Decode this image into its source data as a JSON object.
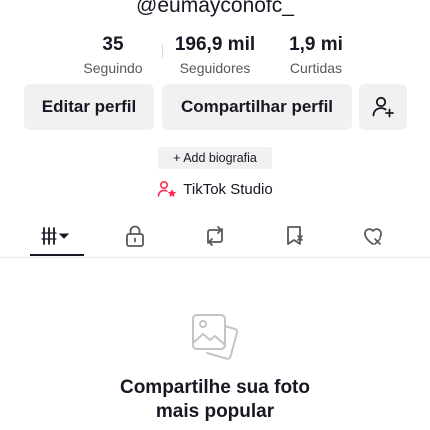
{
  "profile": {
    "username": "@eumayconofc_"
  },
  "stats": [
    {
      "value": "35",
      "label": "Seguindo"
    },
    {
      "value": "196,9 mil",
      "label": "Seguidores"
    },
    {
      "value": "1,9 mi",
      "label": "Curtidas"
    }
  ],
  "actions": {
    "edit_label": "Editar perfil",
    "share_label": "Compartilhar perfil",
    "add_friend_icon": "add-user-icon"
  },
  "bio": {
    "add_label": "+ Add biografia"
  },
  "studio": {
    "label": "TikTok Studio",
    "icon": "person-star-icon",
    "icon_color": "#fe2c55"
  },
  "tabs": [
    {
      "icon": "grid-dropdown-icon",
      "selected": true
    },
    {
      "icon": "lock-icon",
      "selected": false
    },
    {
      "icon": "repost-icon",
      "selected": false
    },
    {
      "icon": "bookmark-icon",
      "selected": false
    },
    {
      "icon": "liked-icon",
      "selected": false
    }
  ],
  "empty_state": {
    "icon": "photo-icon",
    "line1": "Compartilhe sua foto",
    "line2": "mais popular"
  },
  "colors": {
    "text": "#161823",
    "secondary_text": "#57585e",
    "button_bg": "#f1f1f2"
  }
}
